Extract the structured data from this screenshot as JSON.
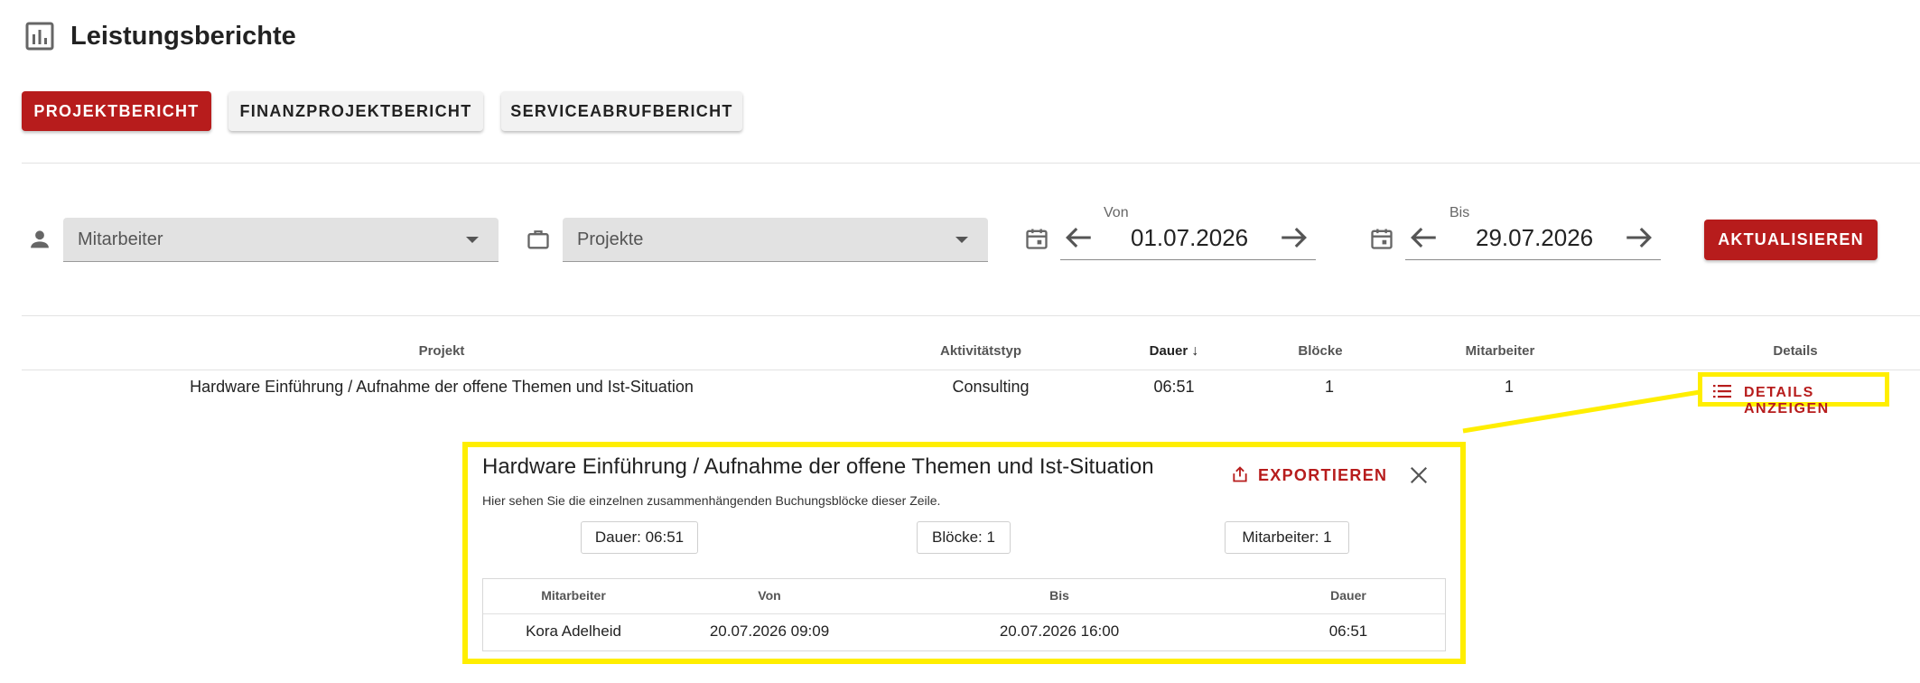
{
  "page": {
    "title": "Leistungsberichte",
    "icon": "bar-chart-icon"
  },
  "tabs": [
    {
      "label": "PROJEKTBERICHT",
      "active": true
    },
    {
      "label": "FINANZPROJEKTBERICHT",
      "active": false
    },
    {
      "label": "SERVICEABRUFBERICHT",
      "active": false
    }
  ],
  "filters": {
    "employee": {
      "placeholder": "Mitarbeiter",
      "icon": "person-icon"
    },
    "projects": {
      "placeholder": "Projekte",
      "icon": "briefcase-icon"
    },
    "from": {
      "label": "Von",
      "value": "01.07.2026",
      "icon": "calendar-icon"
    },
    "to": {
      "label": "Bis",
      "value": "29.07.2026",
      "icon": "calendar-icon"
    },
    "refresh_label": "AKTUALISIEREN"
  },
  "table": {
    "headers": [
      "Projekt",
      "Aktivitätstyp",
      "Dauer",
      "Blöcke",
      "Mitarbeiter",
      "Details"
    ],
    "sort_indicator": "↓",
    "row": {
      "project": "Hardware Einführung / Aufnahme der offene Themen und Ist-Situation",
      "activity": "Consulting",
      "duration": "06:51",
      "blocks": "1",
      "employees": "1",
      "details_label": "DETAILS ANZEIGEN"
    }
  },
  "popup": {
    "title": "Hardware Einführung / Aufnahme der offene Themen und Ist-Situation",
    "subtitle": "Hier sehen Sie die einzelnen zusammenhängenden Buchungsblöcke dieser Zeile.",
    "export_label": "EXPORTIEREN",
    "chips": [
      "Dauer: 06:51",
      "Blöcke: 1",
      "Mitarbeiter: 1"
    ],
    "table": {
      "headers": [
        "Mitarbeiter",
        "Von",
        "Bis",
        "Dauer"
      ],
      "row": [
        "Kora Adelheid",
        "20.07.2026 09:09",
        "20.07.2026 16:00",
        "06:51"
      ]
    }
  },
  "colors": {
    "accent": "#b71c1c",
    "highlight": "#ffee00"
  }
}
